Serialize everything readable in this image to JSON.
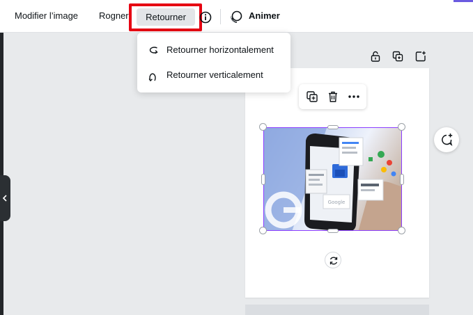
{
  "toolbar": {
    "edit_image_label": "Modifier l’image",
    "crop_label": "Rogner",
    "flip_label": "Retourner",
    "info_icon": "info-icon",
    "animate_label": "Animer",
    "animate_icon": "animate-icon",
    "highlight_color": "#e60012"
  },
  "flip_menu": {
    "items": [
      {
        "label": "Retourner horizontalement",
        "icon": "flip-horizontal-icon"
      },
      {
        "label": "Retourner verticalement",
        "icon": "flip-vertical-icon"
      }
    ]
  },
  "page_actions": {
    "icons": [
      "lock-icon",
      "duplicate-page-icon",
      "add-page-icon"
    ]
  },
  "element_toolbar": {
    "icons": [
      "copy-icon",
      "trash-icon",
      "more-icon"
    ]
  },
  "canvas": {
    "selection_color": "#8b3dff",
    "image_description_icon": "image-phone-google"
  },
  "side_controls": {
    "comment_icon": "add-comment-icon",
    "rotate_icon": "rotate-icon",
    "collapse_icon": "chevron-left-icon"
  }
}
